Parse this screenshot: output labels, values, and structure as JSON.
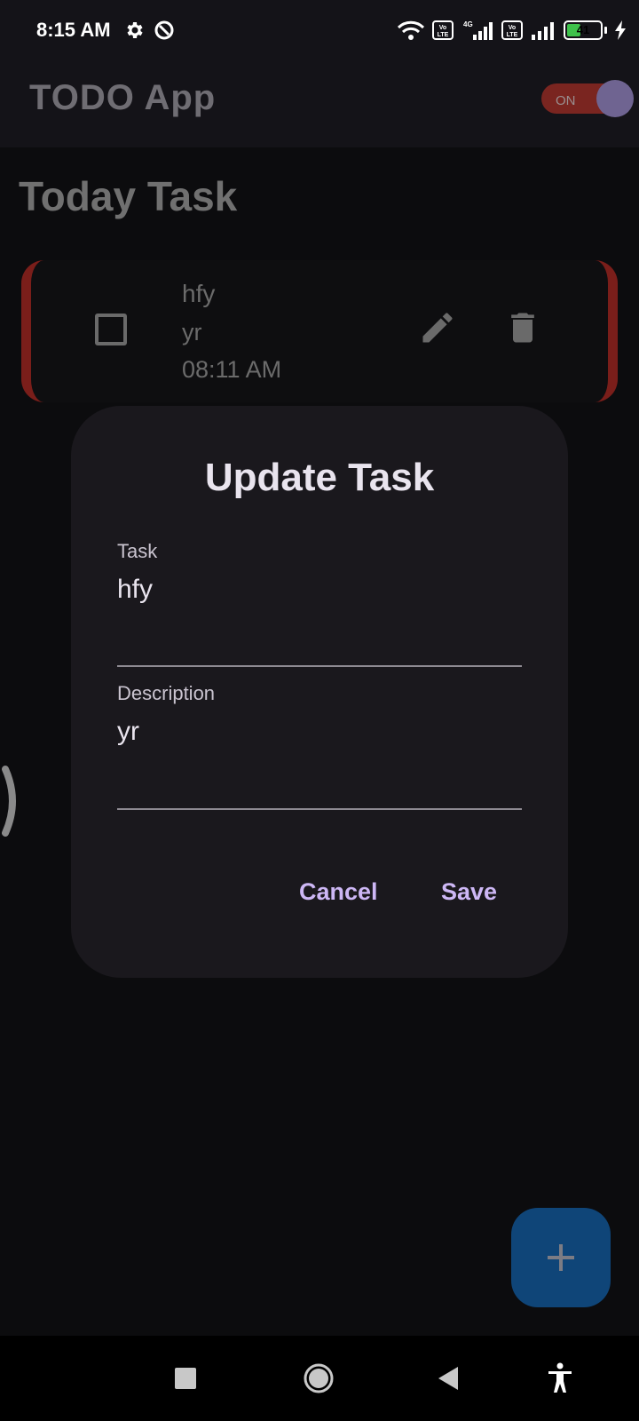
{
  "status_bar": {
    "time": "8:15 AM",
    "battery_level": "41",
    "icons": [
      "gear-icon",
      "data-saver-icon",
      "wifi-icon",
      "volte-icon",
      "signal-4g-icon",
      "volte-icon",
      "signal-icon",
      "battery-icon",
      "charging-icon"
    ]
  },
  "app_bar": {
    "title": "TODO App",
    "toggle_label": "ON"
  },
  "content": {
    "section_title": "Today Task",
    "tasks": [
      {
        "title": "hfy",
        "description": "yr",
        "time": "08:11 AM",
        "accent_color": "#7a1e1a"
      }
    ]
  },
  "dialog": {
    "title": "Update Task",
    "task_label": "Task",
    "task_value": "hfy",
    "description_label": "Description",
    "description_value": "yr",
    "cancel_label": "Cancel",
    "save_label": "Save"
  },
  "fab": {
    "icon": "plus-icon"
  },
  "nav_bar": {
    "icons": [
      "recents-icon",
      "home-icon",
      "back-icon",
      "accessibility-icon"
    ]
  },
  "colors": {
    "background": "#0c0c0e",
    "surface": "#141318",
    "dialog": "#1a181d",
    "accent_text": "#cdb7f5",
    "fab": "#0f4578",
    "toggle_track": "#7a2520"
  }
}
